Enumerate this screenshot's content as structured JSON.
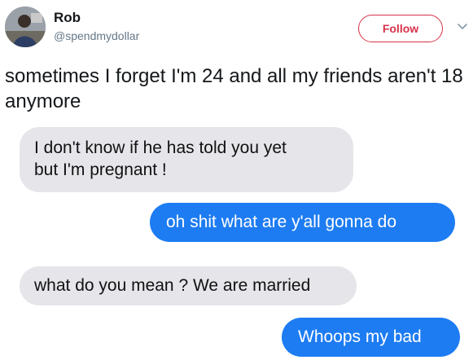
{
  "tweet": {
    "author": {
      "display_name": "Rob",
      "handle": "@spendmydollar",
      "avatar_icon": "user-avatar-photo"
    },
    "follow_label": "Follow",
    "more_icon": "chevron-down-icon",
    "text": "sometimes I forget I'm 24 and all my friends aren't 18 anymore"
  },
  "conversation": {
    "messages": [
      {
        "direction": "received",
        "lines": [
          "I don't know if he has told you yet",
          "but I'm pregnant !"
        ]
      },
      {
        "direction": "sent",
        "lines": [
          "oh shit what are y'all gonna do"
        ]
      },
      {
        "direction": "received",
        "lines": [
          "what do you mean ? We are married"
        ]
      },
      {
        "direction": "sent",
        "lines": [
          "Whoops my bad"
        ]
      }
    ]
  },
  "colors": {
    "follow_accent": "#d8324a",
    "sent_bubble": "#1d7cf2",
    "received_bubble": "#e5e5ea",
    "handle_text": "#657786"
  }
}
